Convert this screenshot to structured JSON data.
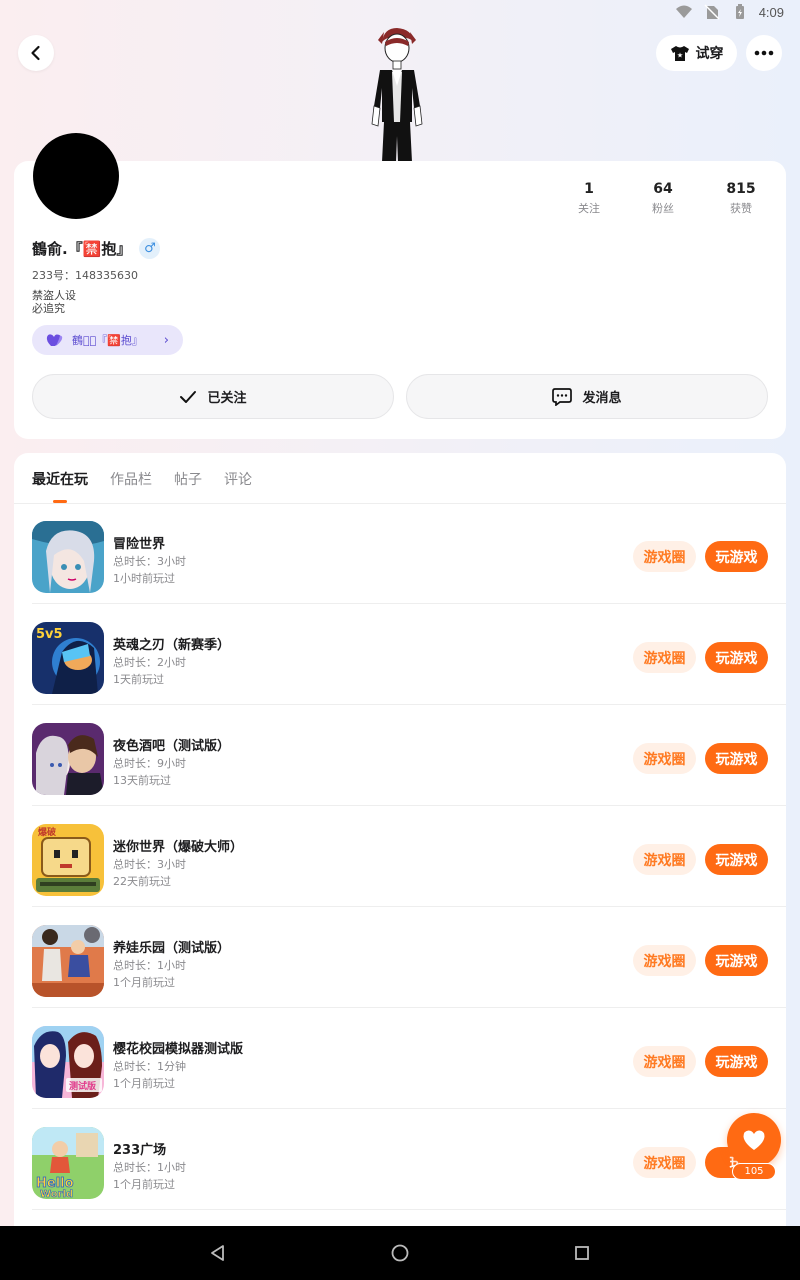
{
  "status_bar": {
    "time": "4:09"
  },
  "header": {
    "tryon_label": "试穿"
  },
  "profile": {
    "nickname": "鶴俞.『🈲抱』",
    "gender_symbol": "♂",
    "uid": "233号：148335630",
    "bio_line1": "禁盗人设",
    "bio_line2": "必追究",
    "badge_text": "鶴煜⃕『🈲抱』",
    "stats": [
      {
        "value": "1",
        "label": "关注"
      },
      {
        "value": "64",
        "label": "粉丝"
      },
      {
        "value": "815",
        "label": "获赞"
      }
    ],
    "follow_label": "已关注",
    "message_label": "发消息"
  },
  "tabs": [
    {
      "label": "最近在玩"
    },
    {
      "label": "作品栏"
    },
    {
      "label": "帖子"
    },
    {
      "label": "评论"
    }
  ],
  "games": [
    {
      "title": "冒险世界",
      "duration": "总时长：3小时",
      "last_played": "1小时前玩过",
      "circle_label": "游戏圈",
      "play_label": "玩游戏"
    },
    {
      "title": "英魂之刃（新赛季）",
      "duration": "总时长：2小时",
      "last_played": "1天前玩过",
      "circle_label": "游戏圈",
      "play_label": "玩游戏"
    },
    {
      "title": "夜色酒吧（测试版）",
      "duration": "总时长：9小时",
      "last_played": "13天前玩过",
      "circle_label": "游戏圈",
      "play_label": "玩游戏"
    },
    {
      "title": "迷你世界（爆破大师）",
      "duration": "总时长：3小时",
      "last_played": "22天前玩过",
      "circle_label": "游戏圈",
      "play_label": "玩游戏"
    },
    {
      "title": "养娃乐园（测试版）",
      "duration": "总时长：1小时",
      "last_played": "1个月前玩过",
      "circle_label": "游戏圈",
      "play_label": "玩游戏"
    },
    {
      "title": "樱花校园模拟器测试版",
      "duration": "总时长：1分钟",
      "last_played": "1个月前玩过",
      "circle_label": "游戏圈",
      "play_label": "玩游戏"
    },
    {
      "title": "233广场",
      "duration": "总时长：1小时",
      "last_played": "1个月前玩过",
      "circle_label": "游戏圈",
      "play_label": "玩"
    }
  ],
  "float_like": {
    "count": "105"
  },
  "colors": {
    "accent": "#ff6a13",
    "accent_soft": "#fff0e6",
    "badge_bg": "#e9e6fb"
  }
}
